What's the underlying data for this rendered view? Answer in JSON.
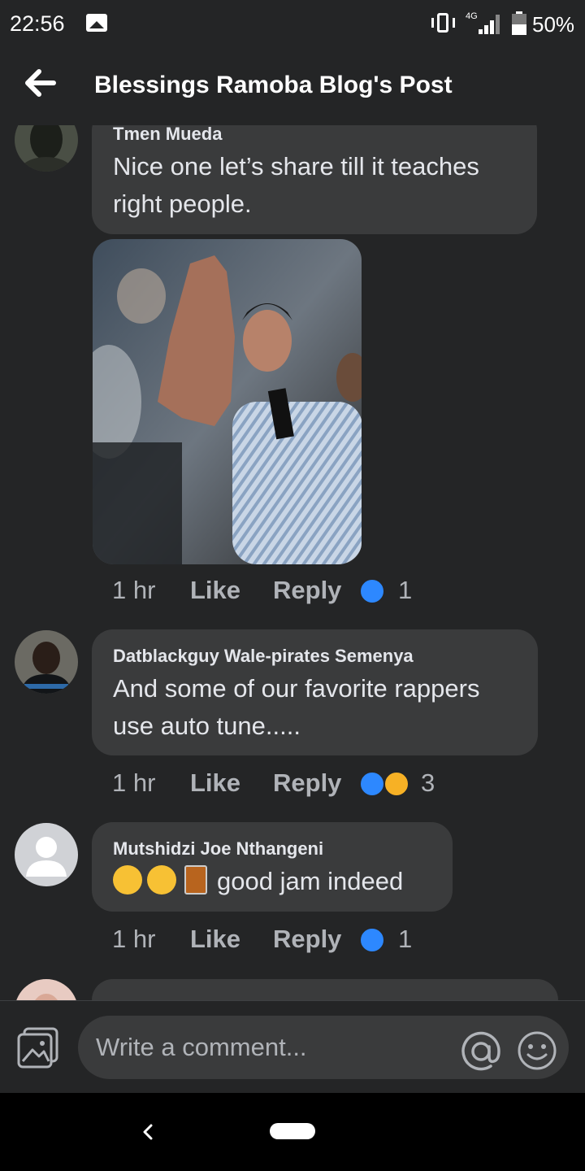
{
  "status_bar": {
    "time": "22:56",
    "network": "4G",
    "battery": "50%"
  },
  "header": {
    "title": "Blessings Ramoba Blog's Post"
  },
  "comments": [
    {
      "author": "Tmen Mueda",
      "lines": [
        "Nice one let’s share till it teaches",
        "right people."
      ],
      "time": "1 hr",
      "like": "Like",
      "reply": "Reply",
      "reaction_count": "1",
      "reactions": [
        "like"
      ]
    },
    {
      "author": "Datblackguy Wale-pirates Semenya",
      "lines": [
        "And some of our favorite rappers",
        "use auto tune....."
      ],
      "time": "1 hr",
      "like": "Like",
      "reply": "Reply",
      "reaction_count": "3",
      "reactions": [
        "like",
        "haha"
      ]
    },
    {
      "author": "Mutshidzi Joe Nthangeni",
      "text": "good jam indeed",
      "emojis": [
        "grinning-emoji",
        "grinning-emoji",
        "whiskey-glass-emoji"
      ],
      "time": "1 hr",
      "like": "Like",
      "reply": "Reply",
      "reaction_count": "1",
      "reactions": [
        "like"
      ]
    }
  ],
  "composer": {
    "placeholder": "Write a comment..."
  },
  "colors": {
    "background": "#242526",
    "bubble": "#3a3b3c",
    "like_blue": "#2d88ff",
    "haha_yellow": "#f7b125"
  }
}
